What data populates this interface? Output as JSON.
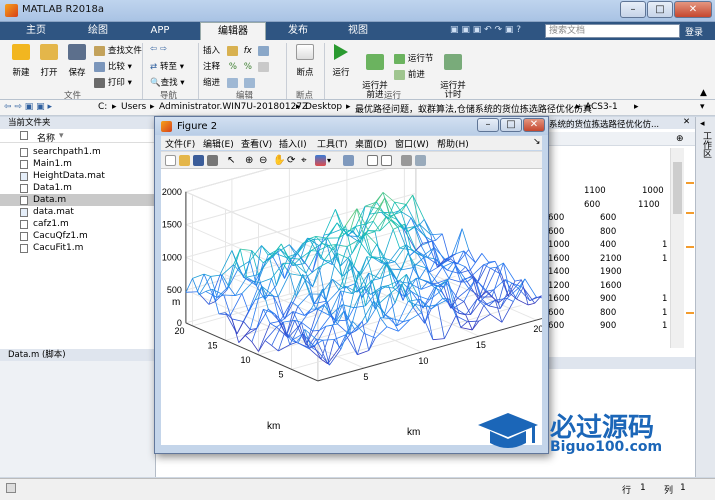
{
  "window": {
    "title": "MATLAB R2018a"
  },
  "tabs": [
    "主页",
    "绘图",
    "APP",
    "编辑器",
    "发布",
    "视图"
  ],
  "search_placeholder": "搜索文档",
  "ribbon": {
    "file": {
      "new": "新建",
      "open": "打开",
      "save": "保存",
      "find_files": "查找文件",
      "compare": "比较",
      "print": "打印",
      "group": "文件"
    },
    "nav": {
      "goto": "转至",
      "find": "查找",
      "group": "导航"
    },
    "edit": {
      "insert": "插入",
      "comment": "注释",
      "indent": "缩进",
      "group": "编辑"
    },
    "breakpoints": {
      "label": "断点",
      "group": "断点"
    },
    "run": {
      "run": "运行",
      "run_advance": "运行并\n前进",
      "run_section": "运行节",
      "advance": "前进",
      "run_time": "运行并\n计时",
      "group": "运行"
    }
  },
  "address": {
    "path": [
      "C:",
      "Users",
      "Administrator.WIN7U-20180127Z",
      "Desktop",
      "最优路径问题，蚁群算法,仓储系统的货位拣选路径优化仿真",
      "ACS3-1"
    ]
  },
  "left_panel": {
    "header": "当前文件夹",
    "column": "名称",
    "files": [
      "searchpath1.m",
      "Main1.m",
      "HeightData.mat",
      "Data1.m",
      "Data.m",
      "data.mat",
      "cafz1.m",
      "CacuQfz1.m",
      "CacuFit1.m"
    ],
    "selected": "Data.m",
    "details": "Data.m  (脚本)"
  },
  "editor_tab": "系统的货位拣选路径优化仿...",
  "workspace_label": "工作区",
  "editor_numbers": [
    [
      "1100",
      "1000"
    ],
    [
      "600",
      "1100"
    ],
    [
      "600",
      "600"
    ],
    [
      "600",
      "800"
    ],
    [
      "1000",
      "400",
      "1"
    ],
    [
      "1600",
      "2100",
      "1"
    ],
    [
      "1400",
      "1900"
    ],
    [
      "1200",
      "1600"
    ],
    [
      "1600",
      "900",
      "1"
    ],
    [
      "600",
      "800",
      "1"
    ],
    [
      "600",
      "900",
      "1"
    ]
  ],
  "status": {
    "row_label": "行",
    "row": "1",
    "col_label": "列",
    "col": "1"
  },
  "figure": {
    "title": "Figure 2",
    "menu": [
      "文件(F)",
      "编辑(E)",
      "查看(V)",
      "插入(I)",
      "工具(T)",
      "桌面(D)",
      "窗口(W)",
      "帮助(H)"
    ],
    "zlabel": "m",
    "xlabel": "km",
    "ylabel": "km",
    "zticks": [
      "2000",
      "1500",
      "1000",
      "500",
      "0"
    ],
    "xticks": [
      "5",
      "10",
      "15",
      "20"
    ],
    "yticks": [
      "20",
      "15",
      "10",
      "5"
    ]
  },
  "logo": {
    "title": "必过源码",
    "url": "Biguo100.com"
  },
  "chart_data": {
    "type": "surface-mesh",
    "x_range": [
      1,
      21
    ],
    "y_range": [
      1,
      21
    ],
    "z_range": [
      0,
      2000
    ],
    "xlabel": "km",
    "ylabel": "km",
    "zlabel": "m"
  }
}
